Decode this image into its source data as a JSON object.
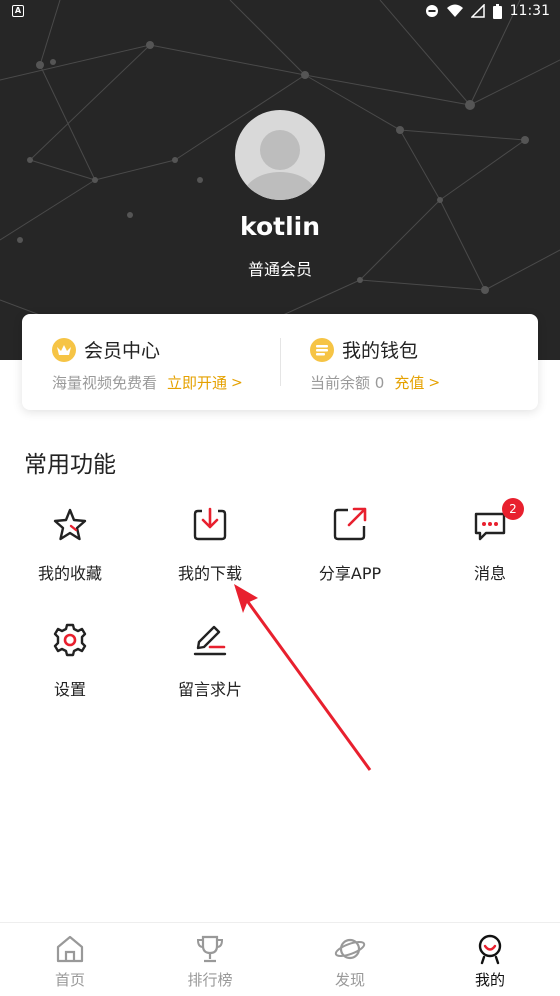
{
  "status_bar": {
    "time": "11:31"
  },
  "profile": {
    "username": "kotlin",
    "level": "普通会员"
  },
  "membership_card": {
    "vip": {
      "title": "会员中心",
      "subtitle": "海量视频免费看",
      "link": "立即开通",
      "chevron": ">"
    },
    "wallet": {
      "title": "我的钱包",
      "subtitle": "当前余额 0",
      "link": "充值",
      "chevron": ">"
    }
  },
  "common_functions": {
    "title": "常用功能",
    "items": [
      {
        "label": "我的收藏",
        "icon": "star-icon"
      },
      {
        "label": "我的下载",
        "icon": "download-icon"
      },
      {
        "label": "分享APP",
        "icon": "share-icon"
      },
      {
        "label": "消息",
        "icon": "message-icon",
        "badge": "2"
      },
      {
        "label": "设置",
        "icon": "gear-icon"
      },
      {
        "label": "留言求片",
        "icon": "edit-icon"
      }
    ]
  },
  "bottom_nav": {
    "items": [
      {
        "label": "首页",
        "icon": "home-icon"
      },
      {
        "label": "排行榜",
        "icon": "trophy-icon"
      },
      {
        "label": "发现",
        "icon": "planet-icon"
      },
      {
        "label": "我的",
        "icon": "profile-icon",
        "active": true
      }
    ]
  },
  "colors": {
    "accent": "#e5a100",
    "badge": "#e8202e",
    "header_bg": "#262626",
    "annotation_arrow": "#e8202e"
  }
}
